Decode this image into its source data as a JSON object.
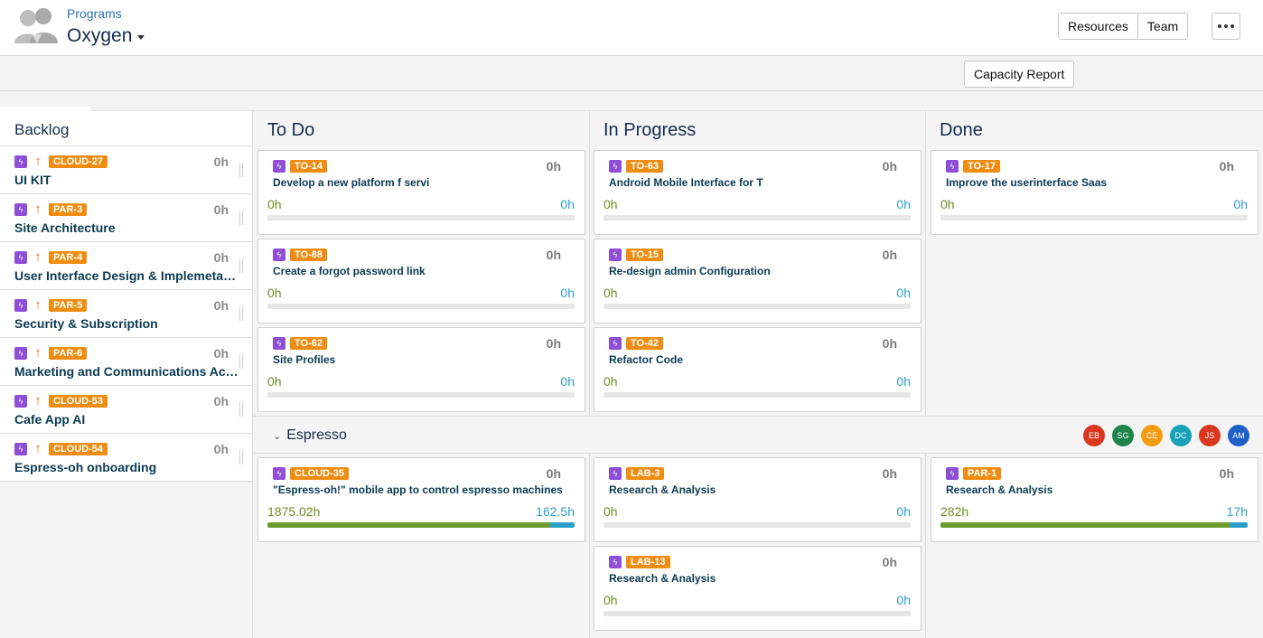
{
  "header": {
    "breadcrumb": "Programs",
    "title": "Oxygen",
    "buttons": [
      "Resources",
      "Team"
    ]
  },
  "toolbar": {
    "capacity_report": "Capacity Report"
  },
  "backlog": {
    "title": "Backlog",
    "items": [
      {
        "key": "CLOUD-27",
        "title": "UI KIT",
        "hours": "0h"
      },
      {
        "key": "PAR-3",
        "title": "Site Architecture",
        "hours": "0h"
      },
      {
        "key": "PAR-4",
        "title": "User Interface Design & Implemetation",
        "hours": "0h"
      },
      {
        "key": "PAR-5",
        "title": "Security & Subscription",
        "hours": "0h"
      },
      {
        "key": "PAR-6",
        "title": "Marketing and Communications Activities",
        "hours": "0h"
      },
      {
        "key": "CLOUD-53",
        "title": "Cafe App AI",
        "hours": "0h"
      },
      {
        "key": "CLOUD-54",
        "title": "Espress-oh onboarding",
        "hours": "0h"
      }
    ]
  },
  "columns": {
    "todo": "To Do",
    "inprogress": "In Progress",
    "done": "Done"
  },
  "cards": {
    "todo": [
      {
        "key": "TO-14",
        "title": "Develop a new platform f servi",
        "hours": "0h",
        "left": "0h",
        "right": "0h"
      },
      {
        "key": "TO-88",
        "title": "Create a forgot password link",
        "hours": "0h",
        "left": "0h",
        "right": "0h"
      },
      {
        "key": "TO-62",
        "title": "Site Profiles",
        "hours": "0h",
        "left": "0h",
        "right": "0h"
      }
    ],
    "inprogress": [
      {
        "key": "TO-63",
        "title": "Android Mobile Interface for T",
        "hours": "0h",
        "left": "0h",
        "right": "0h"
      },
      {
        "key": "TO-15",
        "title": "Re-design admin Configuration",
        "hours": "0h",
        "left": "0h",
        "right": "0h"
      },
      {
        "key": "TO-42",
        "title": "Refactor Code",
        "hours": "0h",
        "left": "0h",
        "right": "0h"
      }
    ],
    "done": [
      {
        "key": "TO-17",
        "title": "Improve the userinterface Saas",
        "hours": "0h",
        "left": "0h",
        "right": "0h"
      }
    ]
  },
  "swimlane": {
    "title": "Espresso",
    "avatars": [
      {
        "initials": "EB",
        "color": "#d9381e"
      },
      {
        "initials": "SG",
        "color": "#1e8449"
      },
      {
        "initials": "CE",
        "color": "#f39c12"
      },
      {
        "initials": "DC",
        "color": "#17a2b8"
      },
      {
        "initials": "JS",
        "color": "#d9381e"
      },
      {
        "initials": "AM",
        "color": "#1f5fc8"
      }
    ],
    "todo": [
      {
        "key": "CLOUD-35",
        "title": "\"Espress-oh!\" mobile app to control espresso machines",
        "hours": "0h",
        "left": "1875.02h",
        "right": "162.5h",
        "progress": 0.92
      }
    ],
    "inprogress": [
      {
        "key": "LAB-3",
        "title": "Research & Analysis",
        "hours": "0h",
        "left": "0h",
        "right": "0h",
        "progress": 0
      },
      {
        "key": "LAB-13",
        "title": "Research & Analysis",
        "hours": "0h",
        "left": "0h",
        "right": "0h",
        "progress": 0
      }
    ],
    "done": [
      {
        "key": "PAR-1",
        "title": "Research & Analysis",
        "hours": "0h",
        "left": "282h",
        "right": "17h",
        "progress": 0.94
      }
    ]
  }
}
